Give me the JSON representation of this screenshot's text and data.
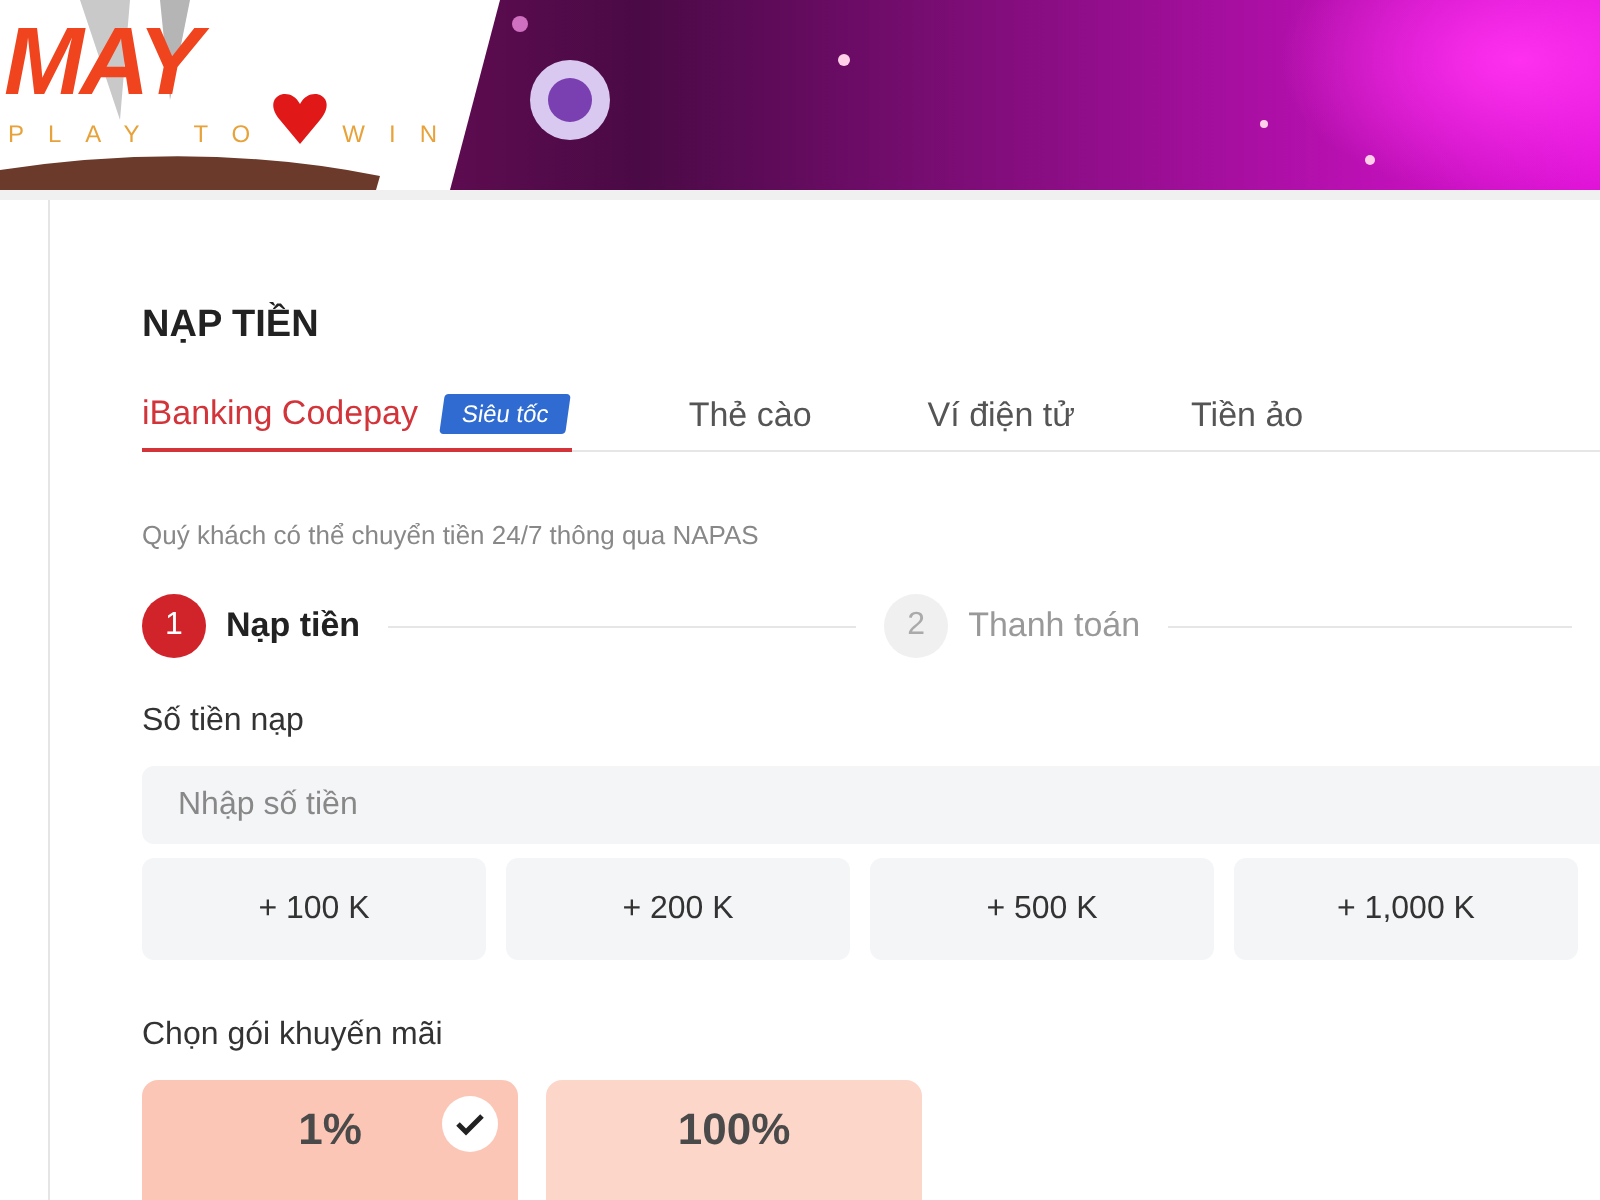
{
  "banner": {
    "logo": "MAY",
    "tagline_left": "PLAY TO",
    "tagline_right": "WIN"
  },
  "title": "NẠP TIỀN",
  "tabs": [
    {
      "label": "iBanking Codepay",
      "badge": "Siêu tốc",
      "selected": true
    },
    {
      "label": "Thẻ cào",
      "selected": false
    },
    {
      "label": "Ví điện tử",
      "selected": false
    },
    {
      "label": "Tiền ảo",
      "selected": false
    }
  ],
  "note": "Quý khách có thể chuyển tiền 24/7 thông qua NAPAS",
  "steps": [
    {
      "number": "1",
      "label": "Nạp tiền",
      "selected": true
    },
    {
      "number": "2",
      "label": "Thanh toán",
      "selected": false
    }
  ],
  "amount": {
    "label": "Số tiền nạp",
    "placeholder": "Nhập số tiền"
  },
  "quick_amounts": [
    "+ 100 K",
    "+ 200 K",
    "+ 500 K",
    "+ 1,000 K"
  ],
  "promo": {
    "label": "Chọn gói khuyến mãi",
    "packages": [
      {
        "value": "1%",
        "selected": true
      },
      {
        "value": "100%",
        "selected": false
      }
    ]
  }
}
